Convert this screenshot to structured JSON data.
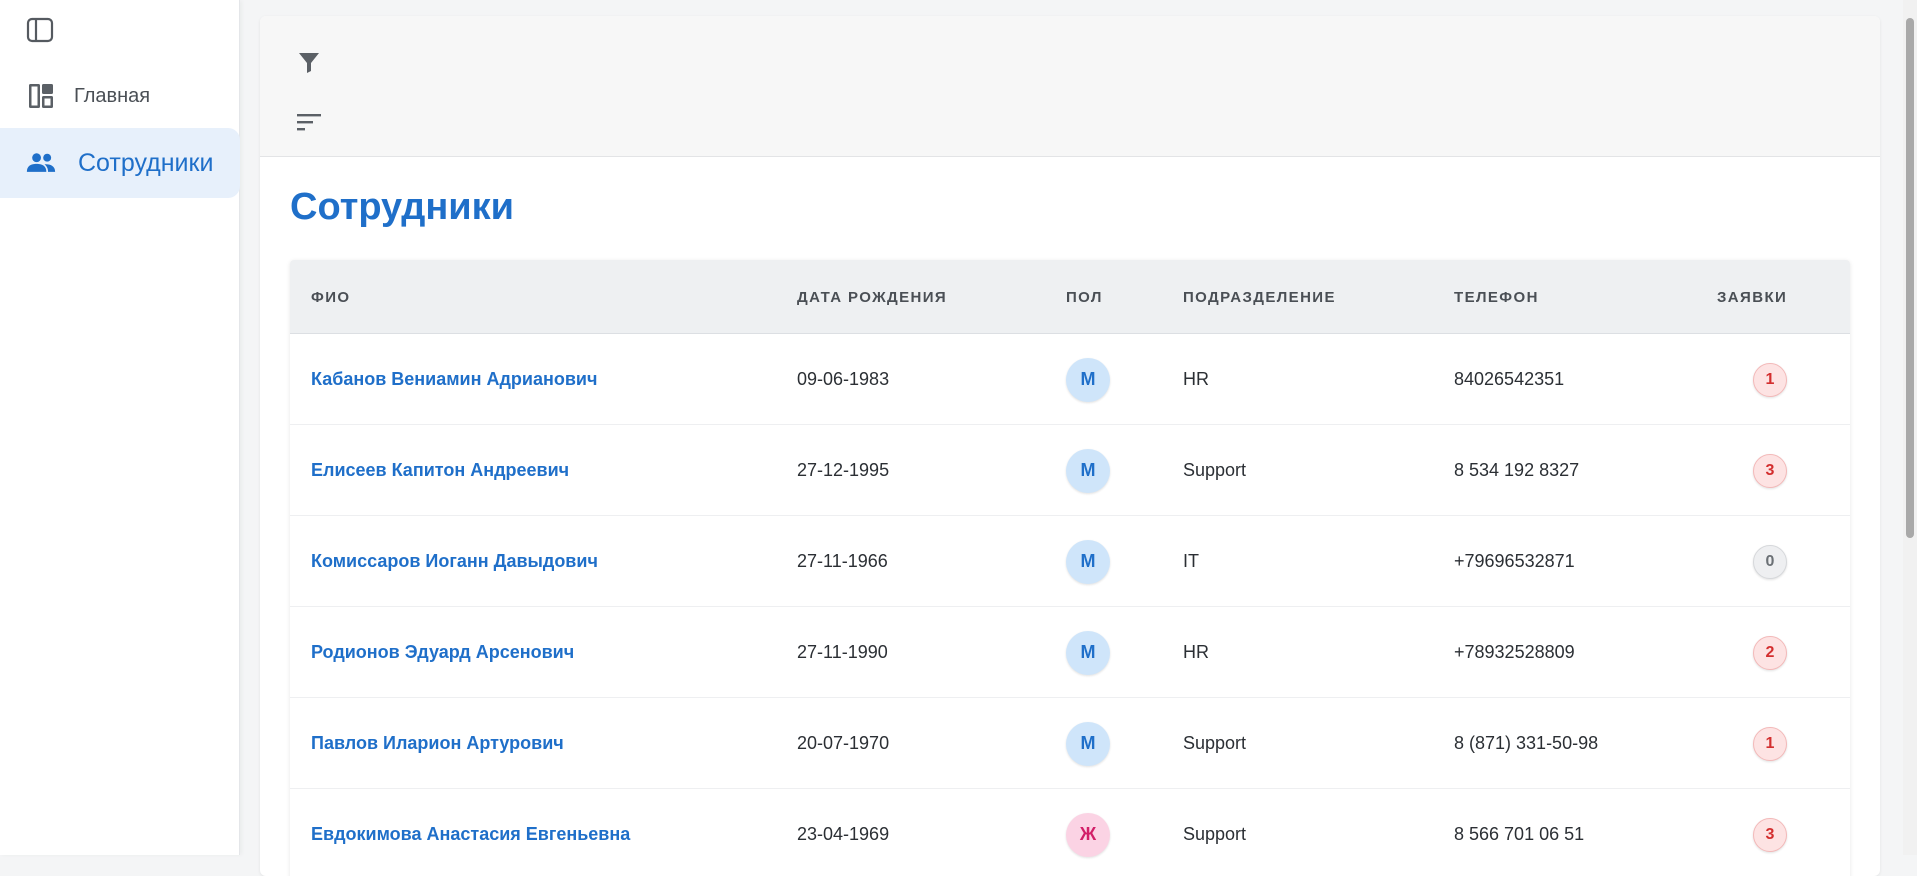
{
  "sidebar": {
    "items": [
      {
        "label": "Главная",
        "icon": "dashboard-icon",
        "active": false
      },
      {
        "label": "Сотрудники",
        "icon": "people-icon",
        "active": true
      }
    ]
  },
  "main": {
    "title": "Сотрудники",
    "columns": [
      "ФИО",
      "ДАТА РОЖДЕНИЯ",
      "ПОЛ",
      "ПОДРАЗДЕЛЕНИЕ",
      "ТЕЛЕФОН",
      "ЗАЯВКИ"
    ],
    "rows": [
      {
        "name": "Кабанов Вениамин Адрианович",
        "birth": "09-06-1983",
        "sex": "М",
        "dept": "HR",
        "phone": "84026542351",
        "requests": "1"
      },
      {
        "name": "Елисеев Капитон Андреевич",
        "birth": "27-12-1995",
        "sex": "М",
        "dept": "Support",
        "phone": "8 534 192 8327",
        "requests": "3"
      },
      {
        "name": "Комиссаров Иоганн Давыдович",
        "birth": "27-11-1966",
        "sex": "М",
        "dept": "IT",
        "phone": "+79696532871",
        "requests": "0"
      },
      {
        "name": "Родионов Эдуард Арсенович",
        "birth": "27-11-1990",
        "sex": "М",
        "dept": "HR",
        "phone": "+78932528809",
        "requests": "2"
      },
      {
        "name": "Павлов Иларион Артурович",
        "birth": "20-07-1970",
        "sex": "М",
        "dept": "Support",
        "phone": "8 (871) 331-50-98",
        "requests": "1"
      },
      {
        "name": "Евдокимова Анастасия Евгеньевна",
        "birth": "23-04-1969",
        "sex": "Ж",
        "dept": "Support",
        "phone": "8 566 701 06 51",
        "requests": "3"
      }
    ]
  },
  "colors": {
    "accent": "#1f6fc9",
    "active_nav_bg": "#e7f0fb",
    "male_badge_bg": "#cfe5fa",
    "female_badge_bg": "#fbd3e4",
    "female_badge_fg": "#d21f68",
    "request_badge_fg": "#d32f2f"
  }
}
